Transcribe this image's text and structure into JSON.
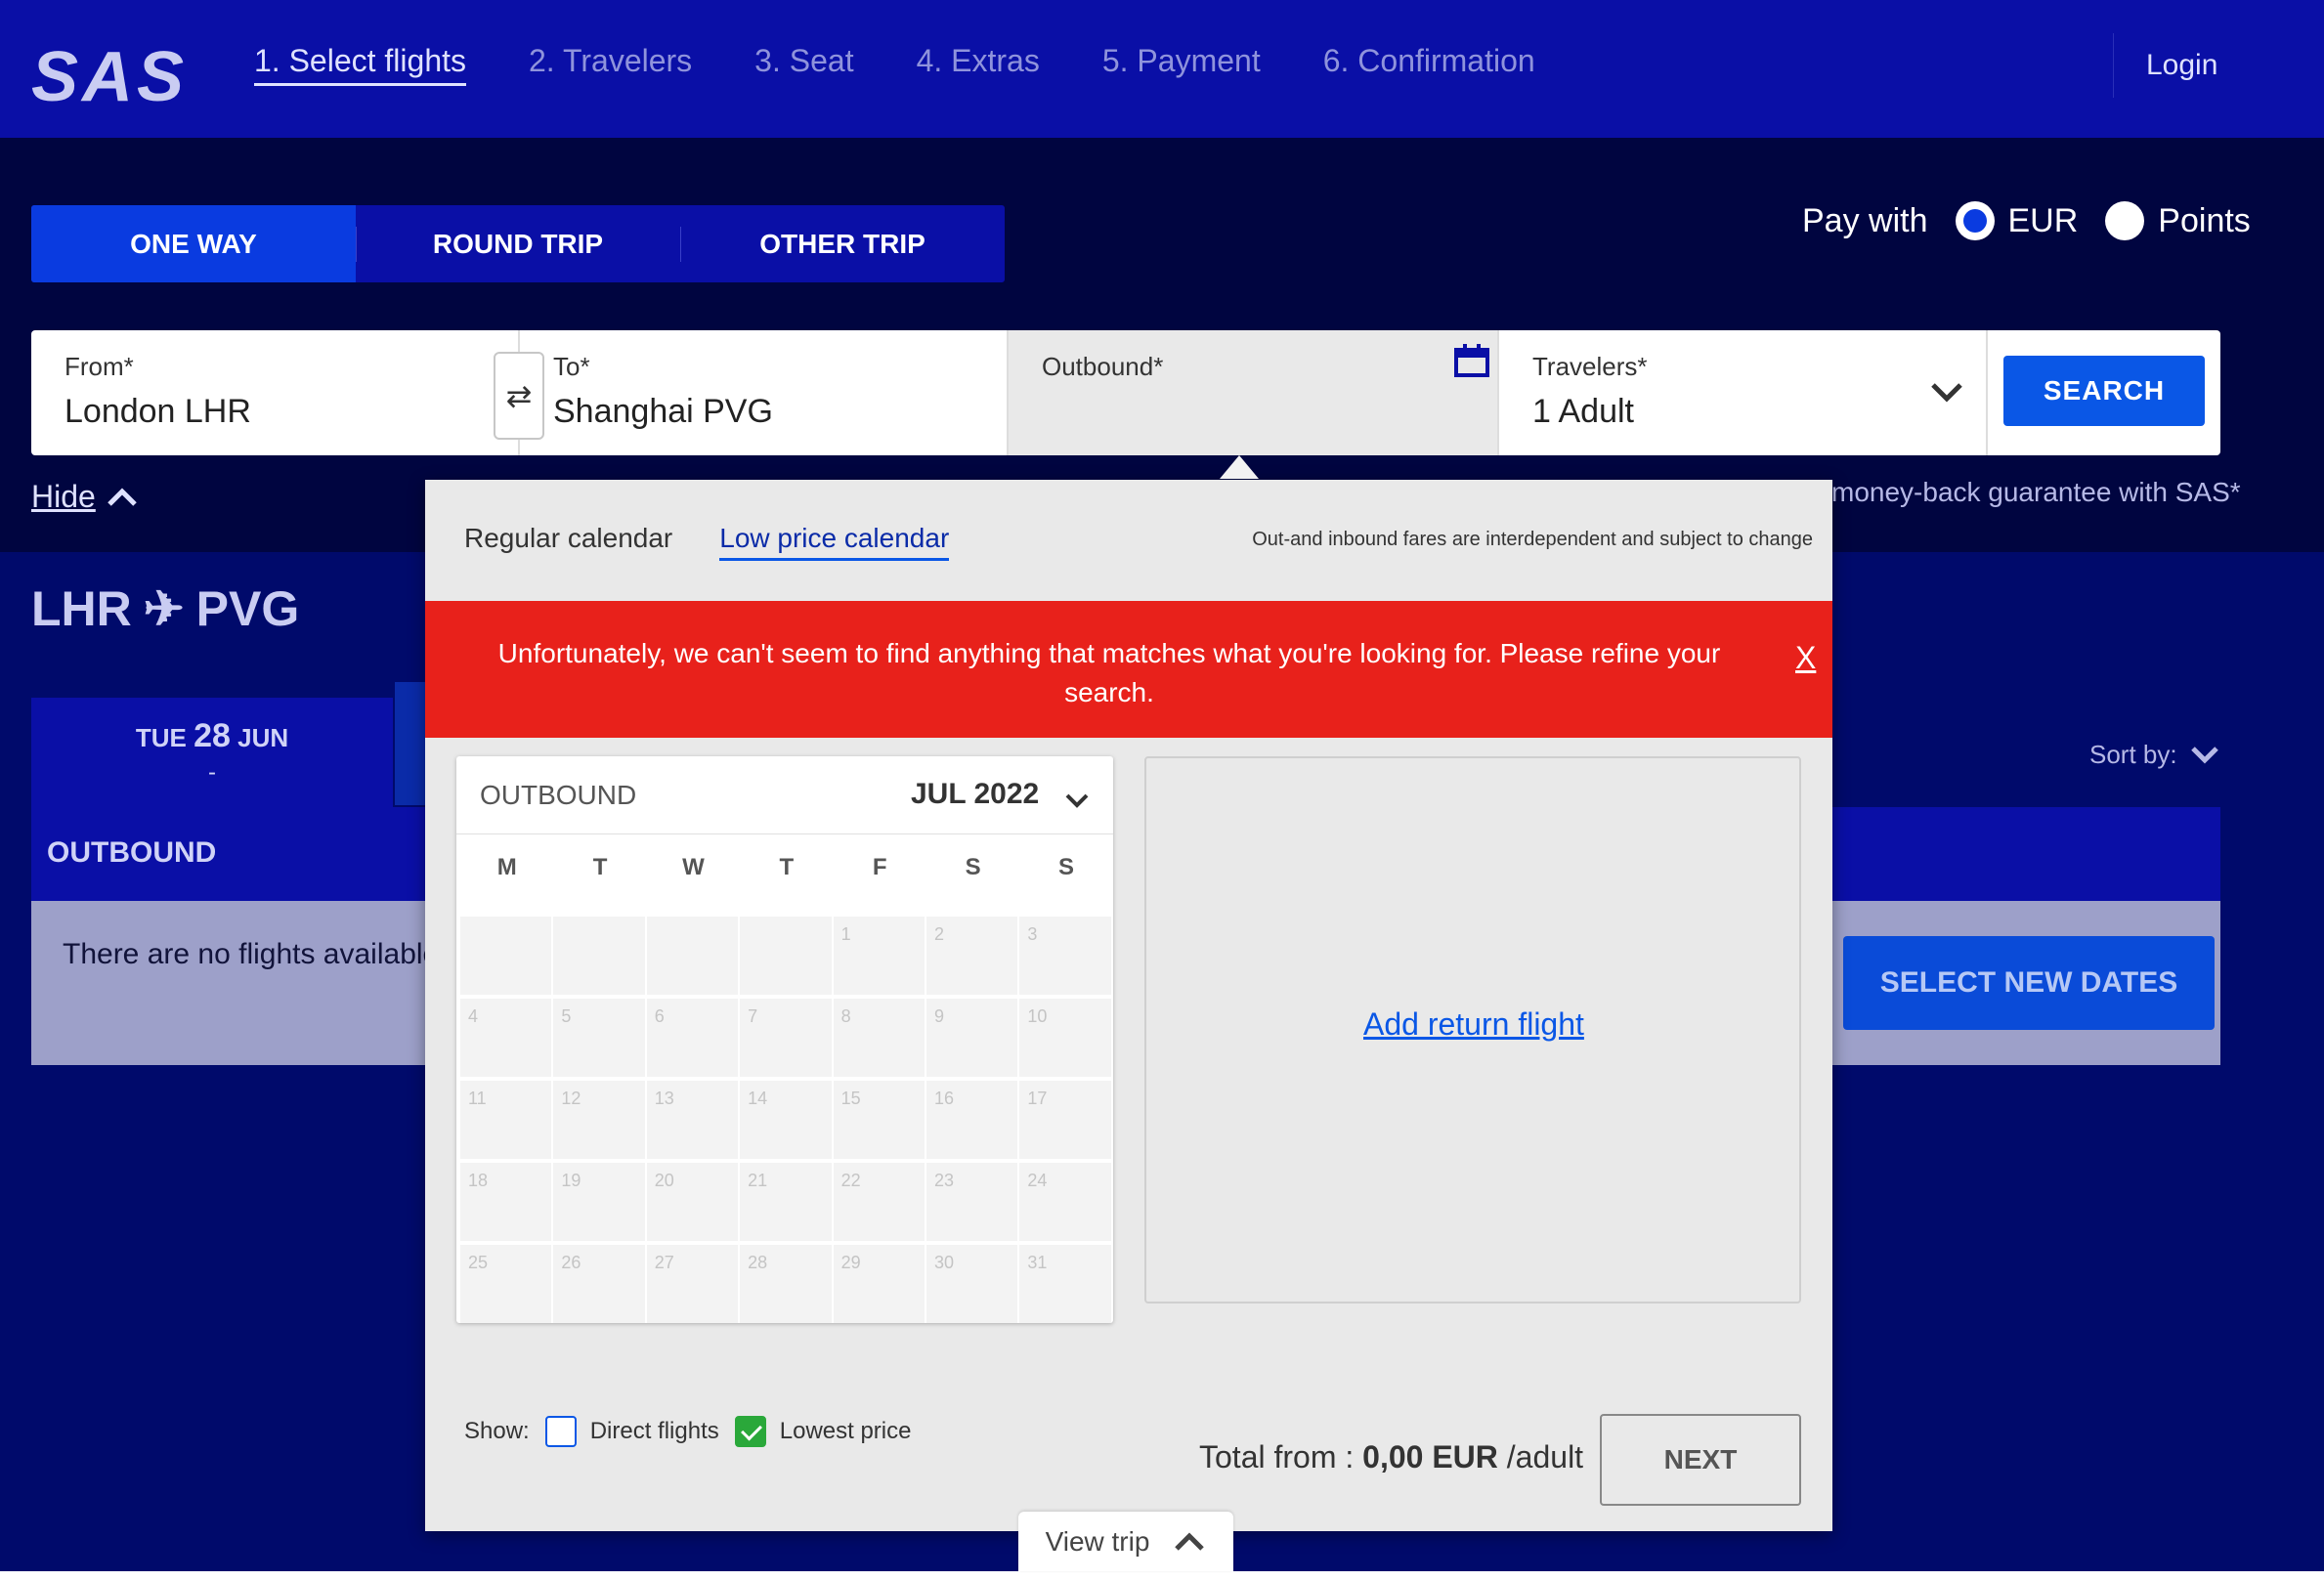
{
  "nav": {
    "logo": "SAS",
    "steps": [
      "1. Select flights",
      "2. Travelers",
      "3. Seat",
      "4. Extras",
      "5. Payment",
      "6. Confirmation"
    ],
    "login": "Login"
  },
  "trip_tabs": [
    "ONE WAY",
    "ROUND TRIP",
    "OTHER TRIP"
  ],
  "pay_with": {
    "label": "Pay with",
    "options": [
      "EUR",
      "Points"
    ],
    "selected": "EUR"
  },
  "search": {
    "from_label": "From*",
    "from_value": "London LHR",
    "to_label": "To*",
    "to_value": "Shanghai PVG",
    "outbound_label": "Outbound*",
    "travelers_label": "Travelers*",
    "travelers_value": "1 Adult",
    "search_button": "SEARCH",
    "swap_icon": "⇄"
  },
  "hide_link": "Hide",
  "money_back": "money-back guarantee with SAS*",
  "route": {
    "from": "LHR",
    "to": "PVG",
    "plane_icon": "✈"
  },
  "date_card": {
    "weekday": "TUE",
    "day": "28",
    "month": "JUN",
    "price": "-"
  },
  "sort_by": "Sort by:",
  "outbound_header": "OUTBOUND",
  "no_flights_msg": "There are no flights available f",
  "select_new_dates": "SELECT NEW DATES",
  "calendar": {
    "tabs": [
      "Regular calendar",
      "Low price calendar"
    ],
    "active_tab": "Low price calendar",
    "fare_note": "Out-and inbound fares are interdependent and subject to change",
    "error": "Unfortunately, we can't seem to find anything that matches what you're looking for. Please refine your search.",
    "error_close": "X",
    "outbound_label": "OUTBOUND",
    "month": "JUL 2022",
    "weekdays": [
      "M",
      "T",
      "W",
      "T",
      "F",
      "S",
      "S"
    ],
    "add_return": "Add return flight",
    "show_label": "Show:",
    "direct_flights": "Direct flights",
    "direct_checked": false,
    "lowest_price": "Lowest price",
    "lowest_checked": true,
    "total_prefix": "Total from :",
    "total_value": "0,00 EUR",
    "total_suffix": "/adult",
    "next_button": "NEXT"
  },
  "view_trip": "View trip",
  "colors": {
    "brand_dark": "#000a6b",
    "nav": "#0a0fa6",
    "accent": "#0a57e6",
    "error": "#e8211b"
  }
}
